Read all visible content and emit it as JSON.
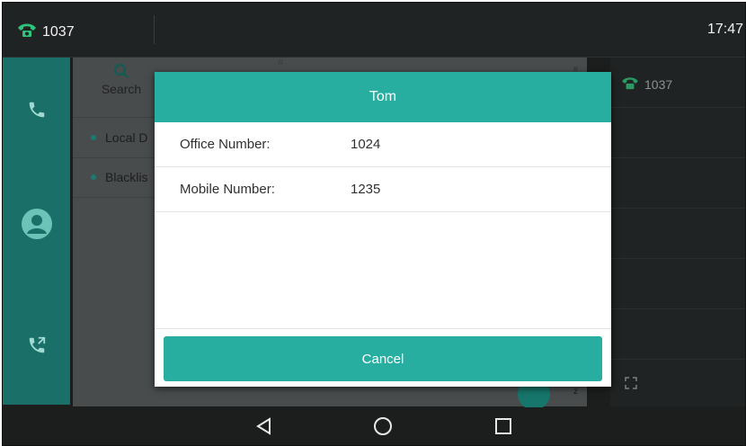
{
  "status_bar": {
    "account_number": "1037",
    "time": "17:47"
  },
  "directory": {
    "search_label": "Search",
    "hash_top": "#",
    "hash_side": "#",
    "index_z": "z",
    "items": [
      {
        "label": "Local D"
      },
      {
        "label": "Blacklis"
      }
    ]
  },
  "right_panel": {
    "account_number": "1037"
  },
  "dialog": {
    "title": "Tom",
    "fields": [
      {
        "label": "Office Number:",
        "value": "1024"
      },
      {
        "label": "Mobile Number:",
        "value": "1235"
      }
    ],
    "cancel_label": "Cancel"
  },
  "colors": {
    "accent": "#28aea1",
    "nav_green": "#1a6f68",
    "background": "#1c1e1e"
  },
  "icons": [
    "phone-icon",
    "handset-icon",
    "contacts-icon",
    "call-forward-icon",
    "search-icon",
    "expand-icon",
    "back-icon",
    "home-icon",
    "recents-icon"
  ]
}
